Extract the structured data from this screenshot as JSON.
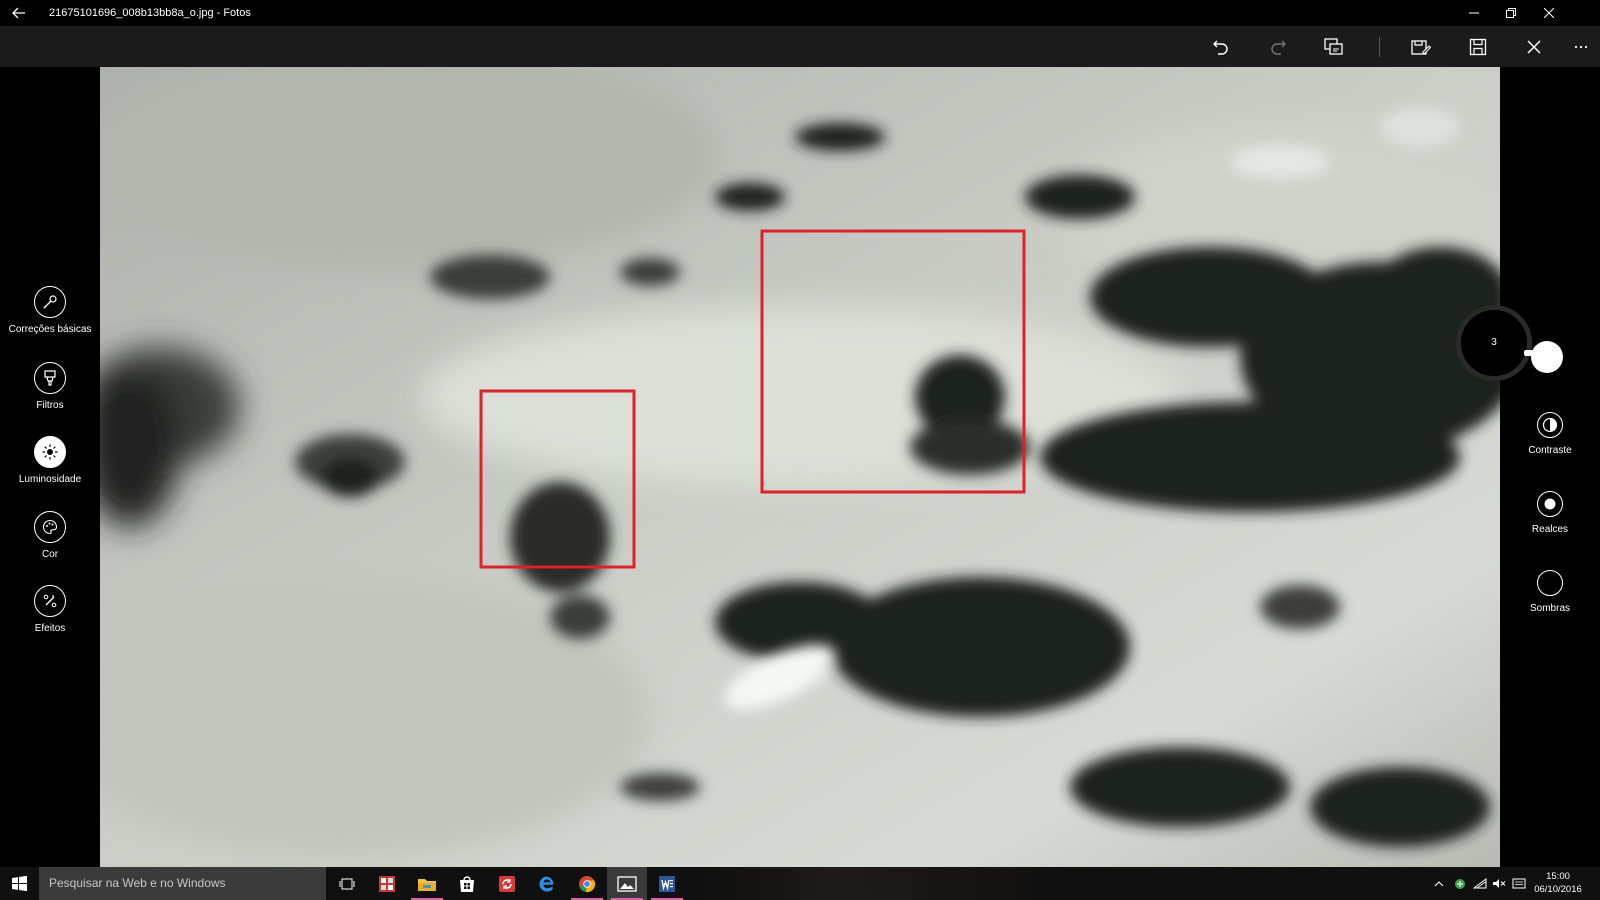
{
  "window": {
    "title": "21675101696_008b13bb8a_o.jpg - Fotos"
  },
  "toolbar": {
    "buttons": [
      "undo-icon",
      "redo-icon",
      "compare-icon",
      "save-copy-icon",
      "save-icon",
      "cancel-icon",
      "more-icon"
    ]
  },
  "left_panel": {
    "tools": [
      {
        "label": "Correções básicas",
        "icon": "wand-icon"
      },
      {
        "label": "Filtros",
        "icon": "filter-icon"
      },
      {
        "label": "Luminosidade",
        "icon": "sun-icon",
        "active": true
      },
      {
        "label": "Cor",
        "icon": "palette-icon"
      },
      {
        "label": "Efeitos",
        "icon": "effects-icon"
      }
    ]
  },
  "right_panel": {
    "dial_value": "3",
    "tools": [
      {
        "label": "Contraste",
        "icon": "contrast-icon"
      },
      {
        "label": "Realces",
        "icon": "highlights-icon"
      },
      {
        "label": "Sombras",
        "icon": "shadows-icon"
      }
    ]
  },
  "taskbar": {
    "search_placeholder": "Pesquisar na Web e no Windows",
    "apps": [
      "task-view-icon",
      "app-icon",
      "file-explorer-icon",
      "store-icon",
      "sync-app-icon",
      "edge-icon",
      "chrome-icon",
      "photos-icon",
      "word-icon"
    ],
    "clock": {
      "time": "15:00",
      "date": "06/10/2016"
    }
  },
  "colors": {
    "annotation_box": "#e0202a",
    "toolbar_bg": "#1b1b1b",
    "taskbar_bg": "#101010"
  }
}
